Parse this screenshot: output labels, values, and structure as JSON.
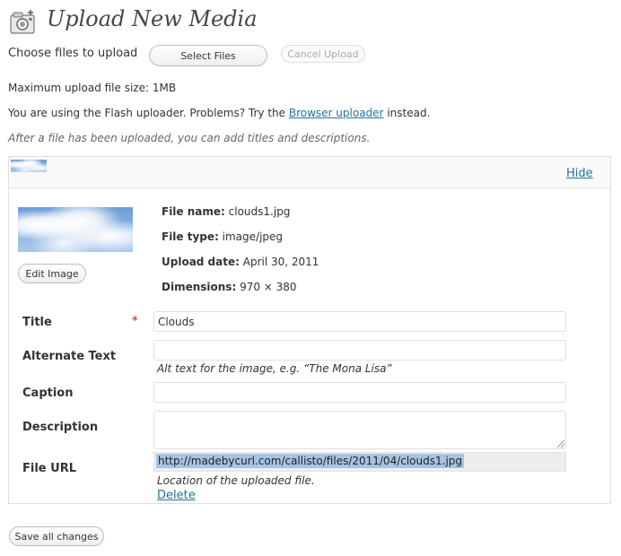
{
  "header": {
    "title": "Upload New Media",
    "icon": "media-upload-icon"
  },
  "uploader": {
    "choose_label": "Choose files to upload",
    "select_files_label": "Select Files",
    "cancel_upload_label": "Cancel Upload",
    "max_size_text": "Maximum upload file size: 1MB",
    "flash_prefix": "You are using the Flash uploader. Problems? Try the ",
    "browser_uploader_link": "Browser uploader",
    "flash_suffix": " instead.",
    "hint": "After a file has been uploaded, you can add titles and descriptions."
  },
  "media_item": {
    "hide_label": "Hide",
    "edit_image_label": "Edit Image",
    "meta": {
      "file_name_label": "File name:",
      "file_name": "clouds1.jpg",
      "file_type_label": "File type:",
      "file_type": "image/jpeg",
      "upload_date_label": "Upload date:",
      "upload_date": "April 30, 2011",
      "dimensions_label": "Dimensions:",
      "dimensions": "970 × 380"
    },
    "fields": {
      "title_label": "Title",
      "required_mark": "*",
      "title_value": "Clouds",
      "alt_label": "Alternate Text",
      "alt_value": "",
      "alt_help": "Alt text for the image, e.g. “The Mona Lisa”",
      "caption_label": "Caption",
      "caption_value": "",
      "description_label": "Description",
      "description_value": "",
      "file_url_label": "File URL",
      "file_url_value": "http://madebycurl.com/callisto/files/2011/04/clouds1.jpg",
      "file_url_help": "Location of the uploaded file."
    },
    "delete_label": "Delete"
  },
  "footer": {
    "save_all_label": "Save all changes"
  },
  "colors": {
    "link": "#21759b",
    "required": "#dd0000",
    "url_highlight": "#a6c4e4"
  }
}
